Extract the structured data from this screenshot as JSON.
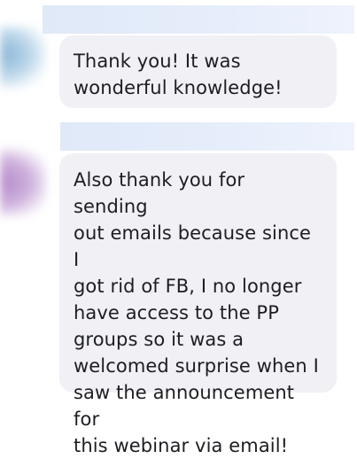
{
  "messages": [
    {
      "text": "Thank you!  It was\nwonderful knowledge!"
    },
    {
      "text": "Also thank you for sending\nout emails because since I\ngot rid of FB, I no longer\nhave access to the PP\ngroups so it was a\nwelcomed surprise when I\nsaw the announcement for\nthis webinar via email!"
    }
  ],
  "colors": {
    "bubble_background": "#f0f0f5",
    "text": "#1c1e21"
  }
}
